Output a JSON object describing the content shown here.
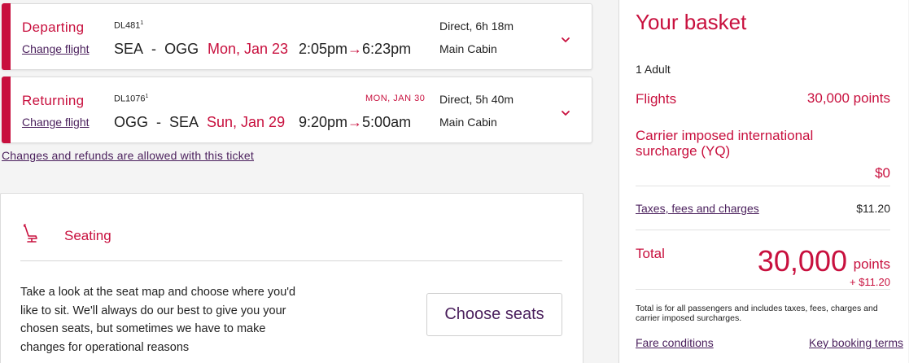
{
  "flights": [
    {
      "direction": "Departing",
      "change_label": "Change flight",
      "flight_number": "DL481",
      "flight_sup": "1",
      "origin": "SEA",
      "separator": "-",
      "destination": "OGG",
      "date": "Mon, Jan 23",
      "depart_time": "2:05pm",
      "arrow": "→",
      "arrive_time": "6:23pm",
      "next_day": "",
      "duration": "Direct, 6h 18m",
      "cabin": "Main Cabin",
      "icon": "chevron-down-icon"
    },
    {
      "direction": "Returning",
      "change_label": "Change flight",
      "flight_number": "DL1076",
      "flight_sup": "1",
      "origin": "OGG",
      "separator": "-",
      "destination": "SEA",
      "date": "Sun, Jan 29",
      "depart_time": "9:20pm",
      "arrow": "→",
      "arrive_time": "5:00am",
      "next_day": "MON, JAN 30",
      "duration": "Direct, 5h 40m",
      "cabin": "Main Cabin",
      "icon": "chevron-down-icon"
    }
  ],
  "policy_link": "Changes and refunds are allowed with this ticket",
  "seating": {
    "icon": "seat-icon",
    "title": "Seating",
    "description": "Take a look at the seat map and choose where you'd like to sit. We'll always do our best to give you your chosen seats, but sometimes we have to make changes for operational reasons",
    "button_label": "Choose seats"
  },
  "basket": {
    "title": "Your basket",
    "passengers": "1 Adult",
    "flights_label": "Flights",
    "flights_value": "30,000 points",
    "surcharge_label": "Carrier imposed international surcharge (YQ)",
    "surcharge_value": "$0",
    "taxes_label": "Taxes, fees and charges",
    "taxes_value": "$11.20",
    "total_label": "Total",
    "total_points": "30,000",
    "total_unit": "points",
    "total_extra": "+ $11.20",
    "disclaimer": "Total is for all passengers and includes taxes, fees, charges and carrier imposed surcharges.",
    "fare_conditions": "Fare conditions",
    "booking_terms": "Key booking terms"
  },
  "colors": {
    "accent_red": "#c8103e",
    "link_purple": "#4a1f5c"
  }
}
